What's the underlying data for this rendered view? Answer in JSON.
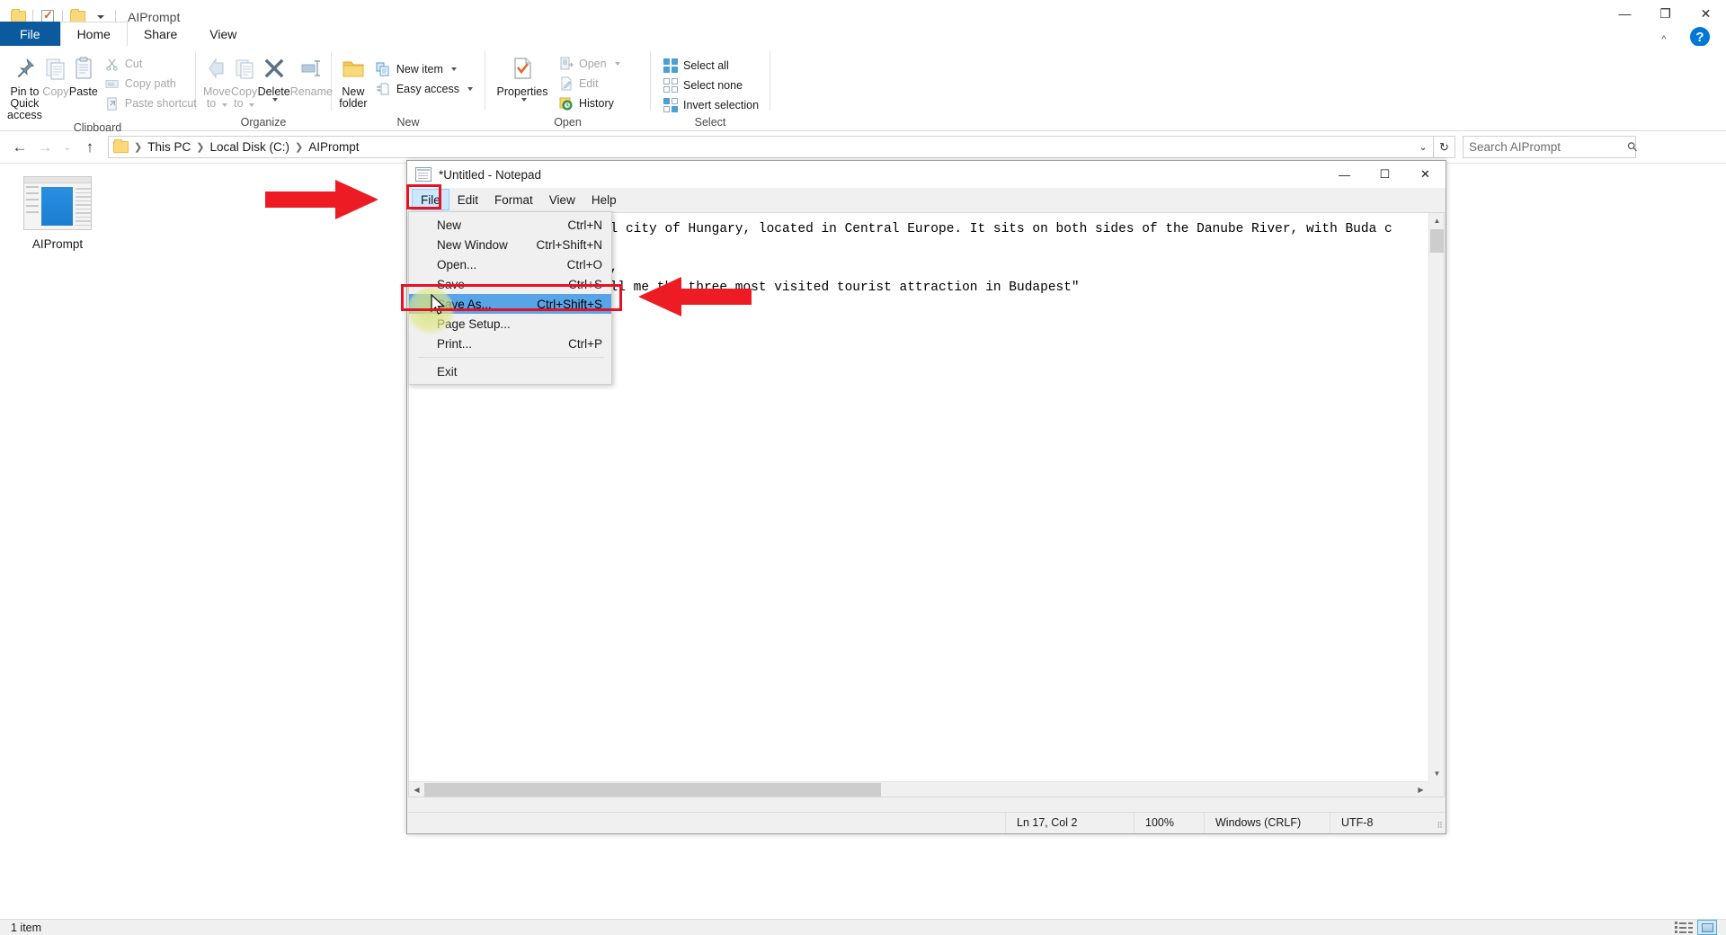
{
  "explorer": {
    "title": "AIPrompt",
    "quick_access_icons": [
      "folder-icon",
      "properties-check-icon",
      "folder-icon",
      "customize-caret-icon"
    ],
    "window_controls": {
      "minimize": "—",
      "maximize": "❐",
      "close": "✕"
    },
    "ribbon_collapse": "^",
    "help": "?",
    "tabs": [
      {
        "label": "File",
        "active": false,
        "kind": "file"
      },
      {
        "label": "Home",
        "active": true,
        "kind": "normal"
      },
      {
        "label": "Share",
        "active": false,
        "kind": "normal"
      },
      {
        "label": "View",
        "active": false,
        "kind": "normal"
      }
    ],
    "ribbon_groups": [
      {
        "label": "Clipboard",
        "big_buttons": [
          {
            "label": "Pin to Quick access",
            "icon": "pin-icon",
            "dim": false
          },
          {
            "label": "Copy",
            "icon": "copy-icon",
            "dim": true
          },
          {
            "label": "Paste",
            "icon": "paste-icon",
            "dim": false
          }
        ],
        "small_buttons": [
          {
            "label": "Cut",
            "icon": "scissors-icon",
            "dim": true
          },
          {
            "label": "Copy path",
            "icon": "copy-path-icon",
            "dim": true
          },
          {
            "label": "Paste shortcut",
            "icon": "paste-shortcut-icon",
            "dim": true
          }
        ]
      },
      {
        "label": "Organize",
        "big_buttons": [
          {
            "label": "Move to",
            "icon": "move-to-icon",
            "dim": true,
            "caret": true
          },
          {
            "label": "Copy to",
            "icon": "copy-to-icon",
            "dim": true,
            "caret": true
          },
          {
            "label": "Delete",
            "icon": "delete-x-icon",
            "dim": false,
            "caret": true
          },
          {
            "label": "Rename",
            "icon": "rename-icon",
            "dim": true
          }
        ],
        "small_buttons": []
      },
      {
        "label": "New",
        "big_buttons": [
          {
            "label": "New folder",
            "icon": "new-folder-icon",
            "dim": false
          }
        ],
        "small_buttons": [
          {
            "label": "New item",
            "icon": "new-item-icon",
            "dim": false,
            "caret": true
          },
          {
            "label": "Easy access",
            "icon": "easy-access-icon",
            "dim": false,
            "caret": true
          }
        ]
      },
      {
        "label": "Open",
        "big_buttons": [
          {
            "label": "Properties",
            "icon": "properties-icon",
            "dim": false,
            "caret": true
          }
        ],
        "small_buttons": [
          {
            "label": "Open",
            "icon": "open-icon",
            "dim": true,
            "caret": true
          },
          {
            "label": "Edit",
            "icon": "edit-icon",
            "dim": true
          },
          {
            "label": "History",
            "icon": "history-icon",
            "dim": false
          }
        ]
      },
      {
        "label": "Select",
        "big_buttons": [],
        "small_buttons": [
          {
            "label": "Select all",
            "icon": "select-all-icon",
            "dim": false
          },
          {
            "label": "Select none",
            "icon": "select-none-icon",
            "dim": false
          },
          {
            "label": "Invert selection",
            "icon": "invert-selection-icon",
            "dim": false
          }
        ]
      }
    ],
    "nav": {
      "back": "←",
      "forward": "→",
      "recent": "⌄",
      "up": "↑"
    },
    "breadcrumbs": [
      "This PC",
      "Local Disk (C:)",
      "AIPrompt"
    ],
    "address_chevron": "⌄",
    "address_refresh": "↻",
    "search": {
      "placeholder": "Search AIPrompt",
      "value": "",
      "icon": "search-icon"
    },
    "items": [
      {
        "name": "AIPrompt",
        "icon": "file-preview-icon"
      }
    ],
    "status": {
      "count": "1 item",
      "views": [
        "details-view-icon",
        "large-icons-view-icon"
      ],
      "active_view": 1
    }
  },
  "notepad": {
    "title": "*Untitled - Notepad",
    "icon": "notepad-icon",
    "window_controls": {
      "minimize": "—",
      "maximize": "☐",
      "close": "✕"
    },
    "menubar": [
      {
        "label": "File",
        "open": true
      },
      {
        "label": "Edit",
        "open": false
      },
      {
        "label": "Format",
        "open": false
      },
      {
        "label": "View",
        "open": false
      },
      {
        "label": "Help",
        "open": false
      }
    ],
    "file_menu": [
      {
        "label": "New",
        "accel": "Ctrl+N",
        "selected": false,
        "separator_after": false
      },
      {
        "label": "New Window",
        "accel": "Ctrl+Shift+N",
        "selected": false,
        "separator_after": false
      },
      {
        "label": "Open...",
        "accel": "Ctrl+O",
        "selected": false,
        "separator_after": false
      },
      {
        "label": "Save",
        "accel": "Ctrl+S",
        "selected": false,
        "separator_after": false
      },
      {
        "label": "Save As...",
        "accel": "Ctrl+Shift+S",
        "selected": true,
        "separator_after": false
      },
      {
        "label": "Page Setup...",
        "accel": "",
        "selected": false,
        "separator_after": false
      },
      {
        "label": "Print...",
        "accel": "Ctrl+P",
        "selected": false,
        "separator_after": true
      },
      {
        "label": "Exit",
        "accel": "",
        "selected": false,
        "separator_after": false
      }
    ],
    "document_text": "            is the capital city of Hungary, located in Central Europe. It sits on both sides of the Danube River, with Buda c\n        {\n            \"role\":\"user\",\n            \"content\":\"Tell me the three most visited tourist attraction in Budapest\"\n        }\n    ]\n}",
    "status": {
      "position": "Ln 17, Col 2",
      "zoom": "100%",
      "line_ending": "Windows (CRLF)",
      "encoding": "UTF-8"
    },
    "scrollbars": {
      "v_up": "▲",
      "v_down": "▼",
      "h_left": "◀",
      "h_right": "▶"
    }
  },
  "annotations": {
    "accent_red": "#e81123",
    "highlight_boxes": [
      {
        "name": "file-menu-highlight"
      },
      {
        "name": "save-as-highlight"
      }
    ],
    "arrows": [
      {
        "name": "arrow-pointing-to-file-menu"
      },
      {
        "name": "arrow-pointing-to-save-as"
      }
    ]
  }
}
